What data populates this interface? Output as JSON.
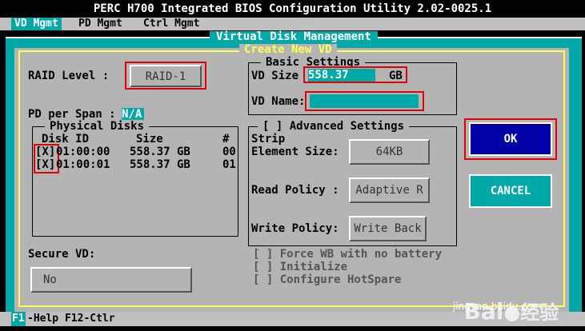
{
  "window": {
    "title": "PERC H700 Integrated BIOS Configuration Utility 2.02-0025.1"
  },
  "menu": {
    "items": [
      {
        "label": "VD Mgmt"
      },
      {
        "label": "PD Mgmt"
      },
      {
        "label": "Ctrl Mgmt"
      }
    ]
  },
  "panel": {
    "title": "Virtual Disk Management"
  },
  "dialog": {
    "title": "Create New VD",
    "raid_level_label": "RAID Level :",
    "raid_level_value": "RAID-1",
    "pd_per_span_label": "PD per Span :",
    "pd_per_span_value": "N/A",
    "physical_disks": {
      "title": "Physical Disks",
      "headers": {
        "disk_id": "Disk ID",
        "size": "Size",
        "num": "#"
      },
      "rows": [
        {
          "check": "[X]",
          "disk_id": "01:00:00",
          "size": "558.37 GB",
          "num": "00"
        },
        {
          "check": "[X]",
          "disk_id": "01:00:01",
          "size": "558.37 GB",
          "num": "01"
        }
      ]
    },
    "secure_vd_label": "Secure VD:",
    "secure_vd_value": "No",
    "basic_settings": {
      "title": "Basic Settings",
      "vd_size_label": "VD Size",
      "vd_size_value": "558.37",
      "vd_size_unit": "GB",
      "vd_name_label": "VD Name:",
      "vd_name_value": ""
    },
    "advanced_settings": {
      "title": "[ ] Advanced Settings",
      "strip_label_line1": "Strip",
      "strip_label_line2": "Element Size:",
      "strip_value": "64KB",
      "read_policy_label": "Read Policy :",
      "read_policy_value": "Adaptive R",
      "write_policy_label": "Write Policy:",
      "write_policy_value": "Write Back",
      "force_wb": "[ ] Force WB with no battery",
      "initialize": "[ ] Initialize",
      "hotspare": "[ ] Configure HotSpare"
    },
    "ok_label": "OK",
    "cancel_label": "CANCEL"
  },
  "status": {
    "f1_key": "F1",
    "text": "-Help F12-Ctlr"
  },
  "watermark": {
    "brand": "Bai",
    "brand2": "经验",
    "url": "jingyan.baidu.com"
  },
  "colors": {
    "accent_teal": "#00a8a8",
    "frame_yellow": "#ffff55",
    "highlight_red": "#e00000",
    "ok_blue": "#0000a8",
    "panel_gray": "#b4b4b4"
  }
}
